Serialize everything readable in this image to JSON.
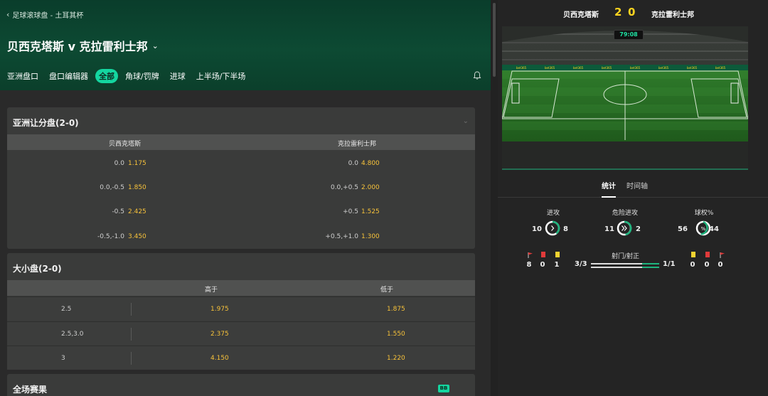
{
  "header": {
    "breadcrumb": "足球滚球盘 - 土耳其杯",
    "title": "贝西克塔斯 v 克拉雷利士邦",
    "tabs": [
      "亚洲盘口",
      "盘口编辑器",
      "全部",
      "角球/罚牌",
      "进球",
      "上半场/下半场"
    ],
    "active_tab": "全部"
  },
  "asian_handicap": {
    "title": "亚洲让分盘(2-0)",
    "col_home": "贝西克塔斯",
    "col_away": "克拉雷利士邦",
    "rows": [
      {
        "home_line": "0.0",
        "home_odds": "1.175",
        "away_line": "0.0",
        "away_odds": "4.800"
      },
      {
        "home_line": "0.0,-0.5",
        "home_odds": "1.850",
        "away_line": "0.0,+0.5",
        "away_odds": "2.000"
      },
      {
        "home_line": "-0.5",
        "home_odds": "2.425",
        "away_line": "+0.5",
        "away_odds": "1.525"
      },
      {
        "home_line": "-0.5,-1.0",
        "home_odds": "3.450",
        "away_line": "+0.5,+1.0",
        "away_odds": "1.300"
      }
    ]
  },
  "totals": {
    "title": "大小盘(2-0)",
    "col_over": "高于",
    "col_under": "低于",
    "rows": [
      {
        "line": "2.5",
        "over": "1.975",
        "under": "1.875"
      },
      {
        "line": "2.5,3.0",
        "over": "2.375",
        "under": "1.550"
      },
      {
        "line": "3",
        "over": "4.150",
        "under": "1.220"
      }
    ]
  },
  "full_time": {
    "title": "全场赛果",
    "badge": "BB"
  },
  "scoreboard": {
    "home": "贝西克塔斯",
    "away": "克拉雷利士邦",
    "home_score": "2",
    "away_score": "0",
    "clock": "79:08"
  },
  "panel_tabs": {
    "stats": "统计",
    "timeline": "时间轴"
  },
  "stats": {
    "attacks": {
      "label": "进攻",
      "home": "10",
      "away": "8"
    },
    "dangerous": {
      "label": "危险进攻",
      "home": "11",
      "away": "2"
    },
    "possession": {
      "label": "球权%",
      "home": "56",
      "away": "44"
    },
    "home_corners": "8",
    "home_red": "0",
    "home_yellow": "1",
    "away_yellow": "0",
    "away_red": "0",
    "away_corners": "0",
    "shots_label": "射门/射正",
    "shots_home": "3/3",
    "shots_away": "1/1"
  },
  "colors": {
    "accent": "#14d6a0",
    "odds": "#f7c23a",
    "score": "#ffd51f",
    "header_green": "#0b442f",
    "yellow_card": "#f2d230",
    "red_card": "#e03a3a"
  }
}
